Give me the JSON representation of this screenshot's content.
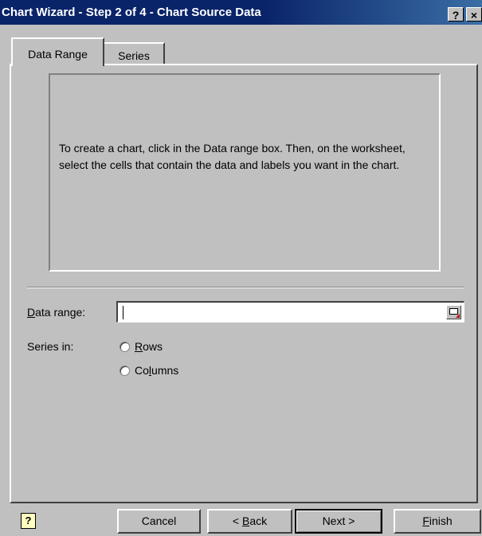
{
  "window": {
    "title": "Chart Wizard - Step 2 of 4 - Chart Source Data",
    "help_button": "?",
    "close_button": "×"
  },
  "tabs": [
    {
      "label": "Data Range",
      "active": true
    },
    {
      "label": "Series",
      "active": false
    }
  ],
  "preview": {
    "message": "To create a chart, click in the Data range box. Then, on the worksheet, select the cells that contain the data and labels you want in the chart."
  },
  "data_range": {
    "label_accel": "D",
    "label_rest": "ata range:",
    "value": ""
  },
  "series_in": {
    "label": "Series in:",
    "options": [
      {
        "pre": "",
        "accel": "R",
        "post": "ows",
        "selected": false
      },
      {
        "pre": "Co",
        "accel": "l",
        "post": "umns",
        "selected": false
      }
    ]
  },
  "buttons": {
    "help_icon": "?",
    "cancel": "Cancel",
    "back_pre": "< ",
    "back_accel": "B",
    "back_post": "ack",
    "next": "Next >",
    "finish_accel": "F",
    "finish_post": "inish"
  }
}
